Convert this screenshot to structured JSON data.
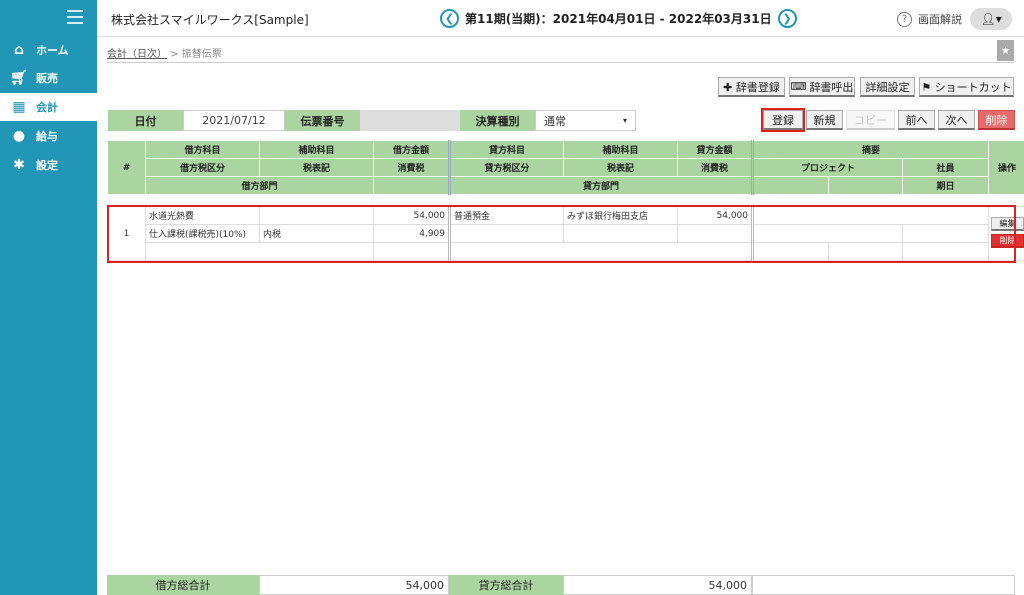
{
  "sidebar": {
    "items": [
      {
        "label": "ホーム",
        "icon": "home-icon"
      },
      {
        "label": "販売",
        "icon": "cart-icon"
      },
      {
        "label": "会計",
        "icon": "calculator-icon"
      },
      {
        "label": "給与",
        "icon": "money-bag-icon"
      },
      {
        "label": "設定",
        "icon": "gear-icon"
      }
    ],
    "active": "会計"
  },
  "header": {
    "company": "株式会社スマイルワークス[Sample]",
    "period": "第11期(当期)：2021年04月01日 - 2022年03月31日",
    "help": "画面解説"
  },
  "breadcrumb": {
    "parent": "会計（日次）",
    "sep": ">",
    "current": "振替伝票"
  },
  "toolbar": {
    "dict_register": "✚ 辞書登録",
    "dict_call": "辞書呼出",
    "detail_settings": "詳細設定",
    "shortcut": "⚑ ショートカット"
  },
  "form": {
    "date_label": "日付",
    "date_value": "2021/07/12",
    "slip_no_label": "伝票番号",
    "slip_no_value": "",
    "settle_label": "決算種別",
    "settle_value": "通常"
  },
  "actions": {
    "register": "登録",
    "new": "新規",
    "copy": "コピー",
    "prev": "前へ",
    "next": "次へ",
    "delete": "削除"
  },
  "grid_headers": {
    "no": "#",
    "debit_account": "借方科目",
    "debit_sub": "補助科目",
    "debit_amount": "借方金額",
    "debit_tax_cat": "借方税区分",
    "debit_tax_note": "税表記",
    "debit_tax": "消費税",
    "debit_dept": "借方部門",
    "credit_account": "貸方科目",
    "credit_sub": "補助科目",
    "credit_amount": "貸方金額",
    "credit_tax_cat": "貸方税区分",
    "credit_tax_note": "税表記",
    "credit_tax": "消費税",
    "credit_dept": "貸方部門",
    "memo": "摘要",
    "project": "プロジェクト",
    "employee": "社員",
    "due": "期日",
    "ops": "操作"
  },
  "row": {
    "no": "1",
    "debit_account": "水道光熱費",
    "debit_amount": "54,000",
    "debit_tax_cat": "仕入課税(課税売)(10%)",
    "debit_tax_note": "内税",
    "debit_tax": "4,909",
    "credit_account": "普通預金",
    "credit_sub": "みずほ銀行梅田支店",
    "credit_amount": "54,000",
    "edit": "編集",
    "delete": "削除"
  },
  "totals": {
    "debit_label": "借方総合計",
    "debit_value": "54,000",
    "credit_label": "貸方総合計",
    "credit_value": "54,000"
  }
}
